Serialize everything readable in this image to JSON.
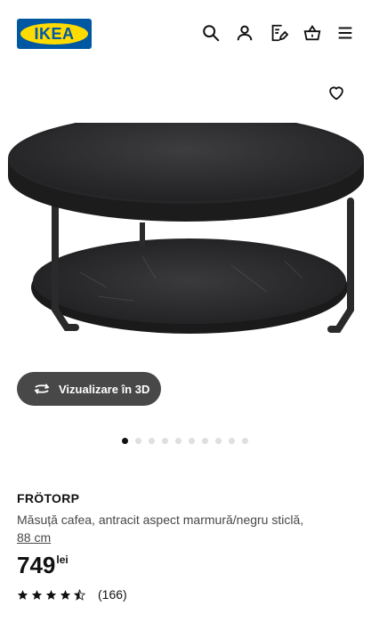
{
  "header": {
    "logo_text": "IKEA",
    "icons": [
      "search-icon",
      "user-icon",
      "shopping-list-icon",
      "basket-icon",
      "menu-icon"
    ]
  },
  "gallery": {
    "favorite_icon": "heart-icon",
    "view3d_label": "Vizualizare în 3D",
    "image_count": 10,
    "active_image_index": 0
  },
  "product": {
    "name": "FRÖTORP",
    "description": "Măsuță cafea, antracit aspect marmură/negru sticlă,",
    "size": "88 cm",
    "price": "749",
    "currency": "lei",
    "rating_stars": 4.5,
    "rating_count": "(166)"
  },
  "colors": {
    "ikea_blue": "#0058a3",
    "ikea_yellow": "#ffdb00",
    "button_dark": "#484848",
    "text": "#111111"
  }
}
